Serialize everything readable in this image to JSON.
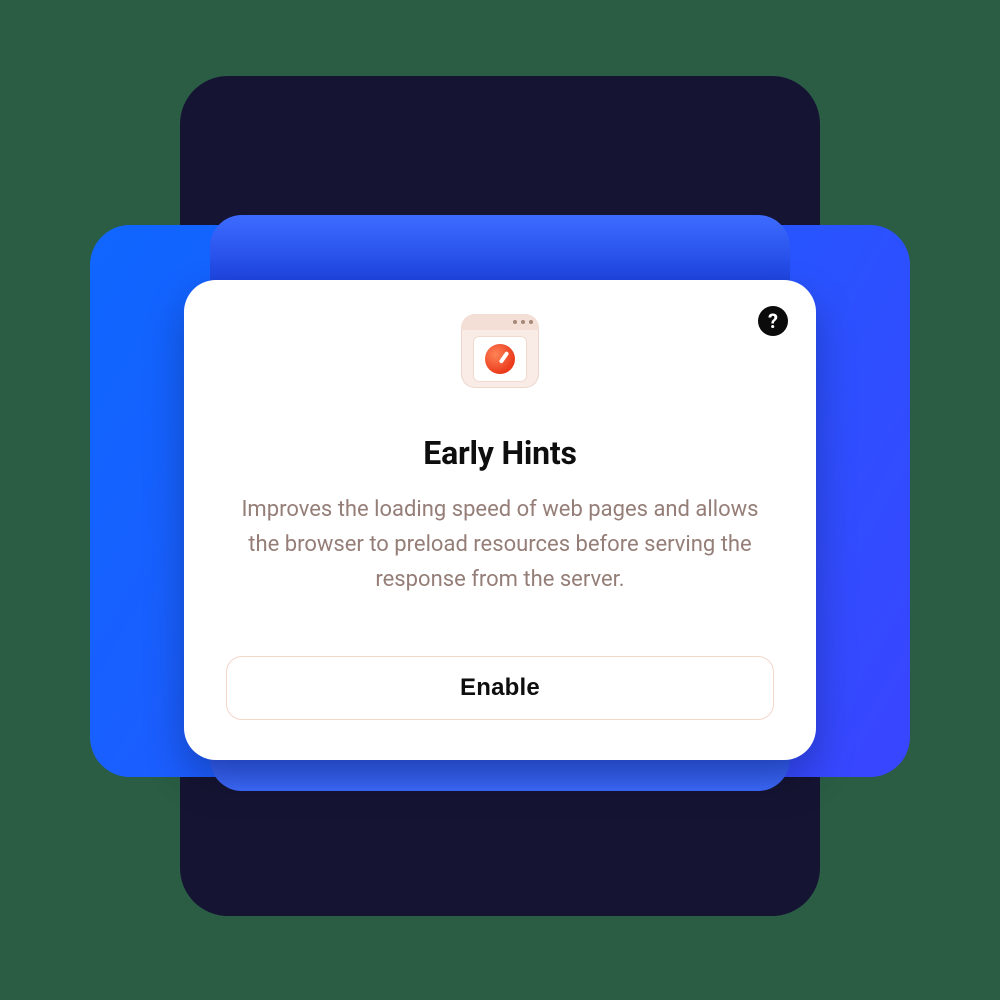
{
  "card": {
    "title": "Early Hints",
    "description": "Improves the loading speed of web pages and allows the browser to preload resources before serving the response from the server.",
    "enable_label": "Enable",
    "help_label": "?"
  },
  "icons": {
    "help": "help-icon",
    "hero": "browser-speed-icon"
  },
  "colors": {
    "page_bg": "#2a5d44",
    "panel_back": "#151433",
    "panel_mid_gradient": [
      "#0f66ff",
      "#3a45ff"
    ],
    "card_bg": "#ffffff",
    "desc_text": "#957e78",
    "button_border": "#f3d7ca"
  }
}
